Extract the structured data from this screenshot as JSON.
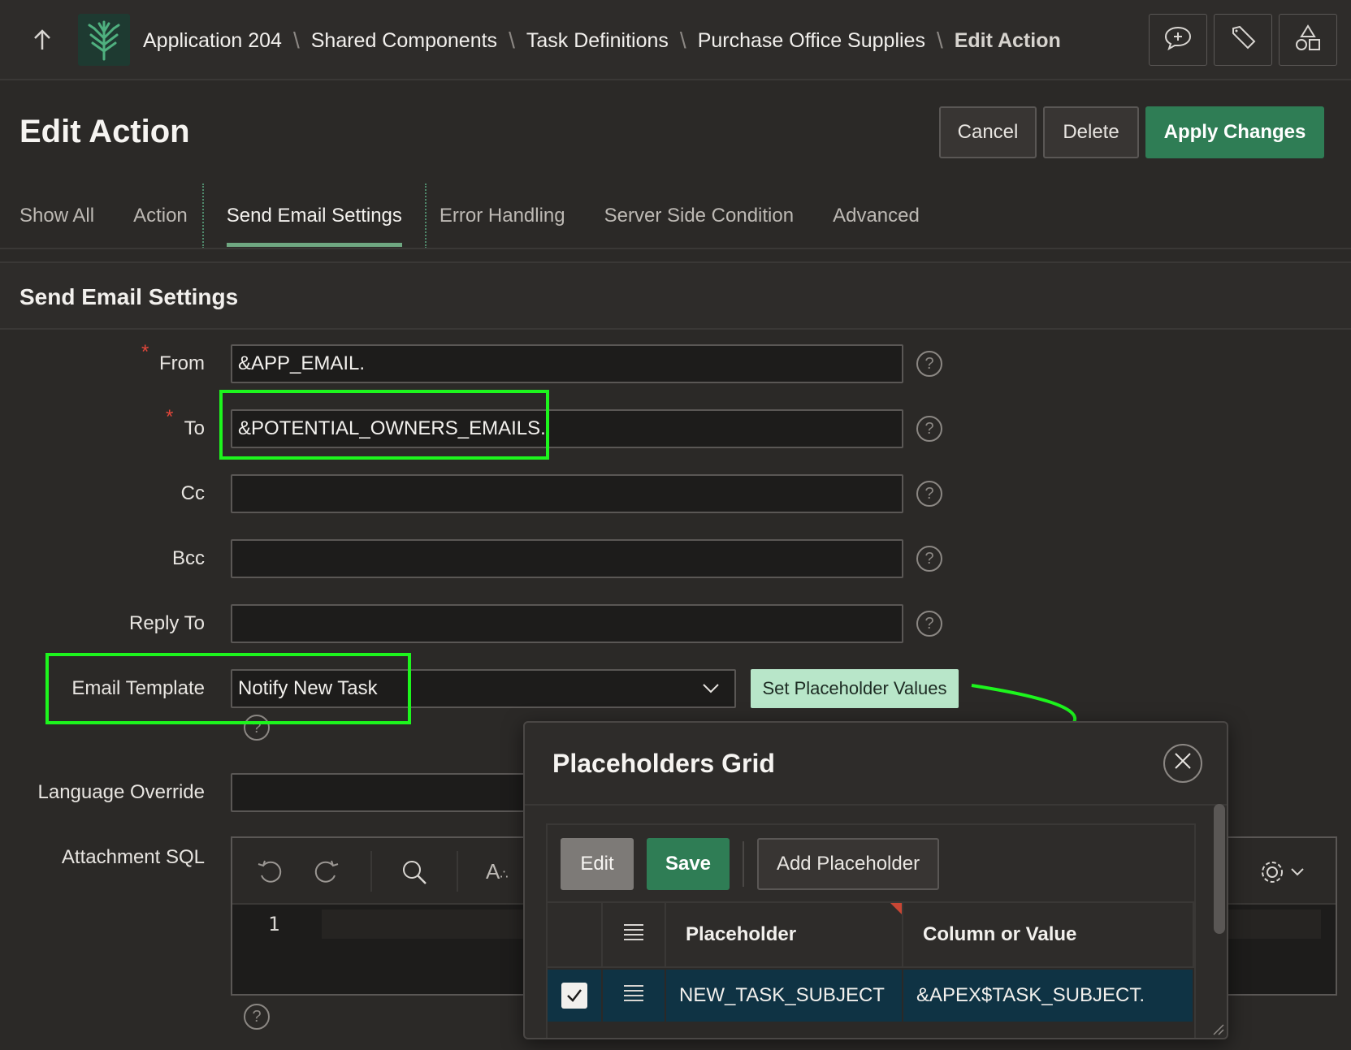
{
  "breadcrumb": {
    "items": [
      "Application 204",
      "Shared Components",
      "Task Definitions",
      "Purchase Office Supplies"
    ],
    "current": "Edit Action"
  },
  "header": {
    "title": "Edit Action",
    "cancel_label": "Cancel",
    "delete_label": "Delete",
    "apply_label": "Apply Changes"
  },
  "tabs": [
    "Show All",
    "Action",
    "Send Email Settings",
    "Error Handling",
    "Server Side Condition",
    "Advanced"
  ],
  "active_tab": "Send Email Settings",
  "region": {
    "title": "Send Email Settings"
  },
  "form": {
    "from_label": "From",
    "from_value": "&APP_EMAIL.",
    "to_label": "To",
    "to_value": "&POTENTIAL_OWNERS_EMAILS.",
    "cc_label": "Cc",
    "cc_value": "",
    "bcc_label": "Bcc",
    "bcc_value": "",
    "reply_to_label": "Reply To",
    "reply_to_value": "",
    "email_template_label": "Email Template",
    "email_template_value": "Notify New Task",
    "set_placeholder_label": "Set Placeholder Values",
    "language_override_label": "Language Override",
    "language_override_value": "",
    "attachment_sql_label": "Attachment SQL",
    "code_line_number": "1",
    "required_marker": "*",
    "help_glyph": "?"
  },
  "dialog": {
    "title": "Placeholders Grid",
    "edit_label": "Edit",
    "save_label": "Save",
    "add_label": "Add Placeholder",
    "columns": [
      "Placeholder",
      "Column or Value"
    ],
    "rows": [
      {
        "placeholder": "NEW_TASK_SUBJECT",
        "value": "&APEX$TASK_SUBJECT."
      }
    ]
  },
  "colors": {
    "accent_green": "#2f7d55",
    "highlight_green": "#1df51d",
    "selected_row": "#0f3344"
  },
  "icons": [
    "up-arrow-icon",
    "app-logo-icon",
    "feedback-icon",
    "edit-icon",
    "shapes-icon",
    "undo-icon",
    "redo-icon",
    "search-icon",
    "text-format-icon",
    "gear-icon",
    "chevron-down-icon",
    "close-icon",
    "row-menu-icon",
    "check-icon"
  ]
}
